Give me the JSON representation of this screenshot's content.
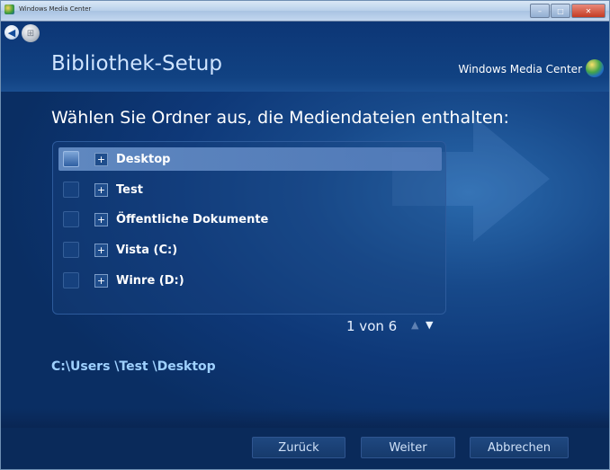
{
  "window": {
    "title": "Windows Media Center"
  },
  "header": {
    "page_title": "Bibliothek-Setup",
    "brand": "Windows Media Center"
  },
  "main": {
    "question": "Wählen Sie Ordner aus, die Mediendateien enthalten:",
    "folders": [
      {
        "label": "Desktop",
        "selected": true
      },
      {
        "label": "Test",
        "selected": false
      },
      {
        "label": "Öffentliche Dokumente",
        "selected": false
      },
      {
        "label": "Vista (C:)",
        "selected": false
      },
      {
        "label": "Winre (D:)",
        "selected": false
      }
    ],
    "pager": "1 von 6",
    "path": "C:\\Users \\Test \\Desktop"
  },
  "footer": {
    "back_label": "Zurück",
    "next_label": "Weiter",
    "cancel_label": "Abbrechen"
  },
  "colors": {
    "background": "#0a2e63",
    "accent_text": "#9fd1ff",
    "title_text": "#cfe4ff"
  },
  "icons": {
    "back": "back-arrow-icon",
    "start": "windows-start-icon",
    "logo": "windows-media-center-logo-icon"
  }
}
